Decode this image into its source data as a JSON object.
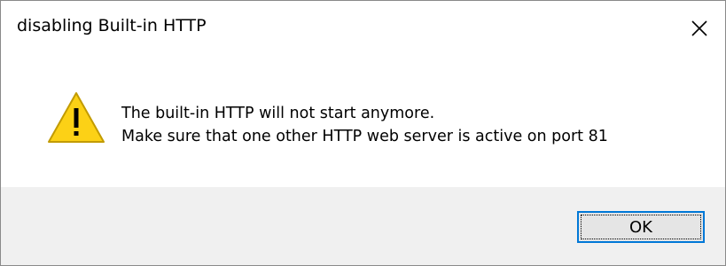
{
  "window": {
    "title": "disabling Built-in HTTP",
    "close_icon": "close-icon"
  },
  "message": {
    "icon": "warning-icon",
    "line1": "The built-in HTTP will not start anymore.",
    "line2": "Make sure that one other HTTP web server is active on port 81"
  },
  "buttons": {
    "ok_label": "OK"
  },
  "colors": {
    "warning_fill": "#fcd116",
    "warning_stroke": "#c29b00",
    "focus_border": "#0078d7",
    "footer_bg": "#f0f0f0"
  }
}
